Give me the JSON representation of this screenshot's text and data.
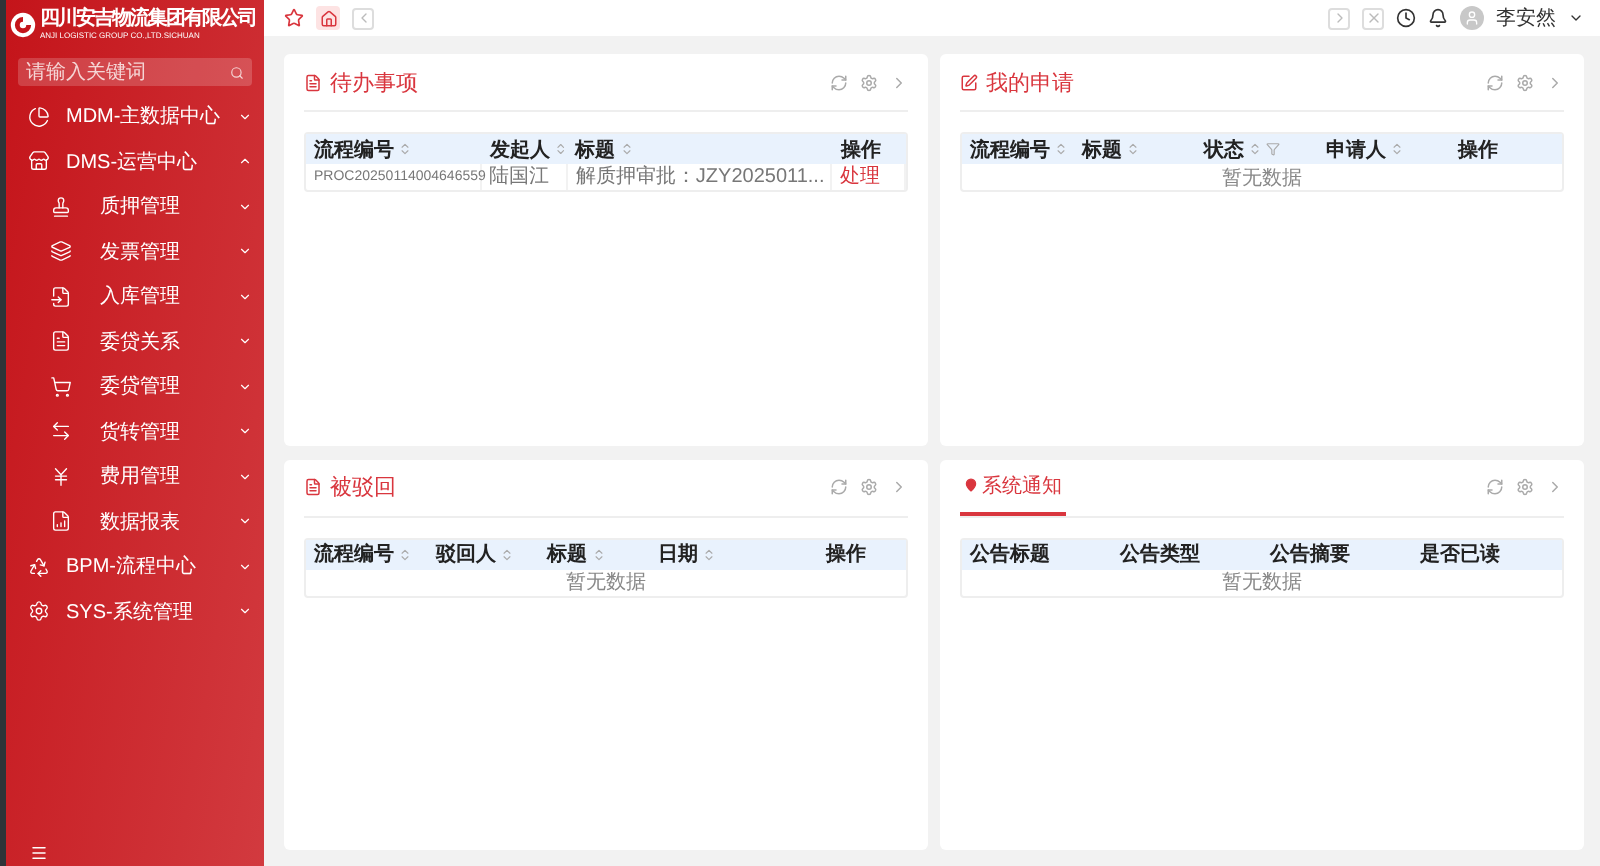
{
  "logo": {
    "name": "四川安吉物流集团有限公司",
    "subtitle": "ANJI LOGISTIC GROUP CO.,LTD.SICHUAN"
  },
  "sidebar": {
    "search": {
      "placeholder": "请输入关键词"
    },
    "items": [
      {
        "label": "MDM-主数据中心",
        "expanded": false
      },
      {
        "label": "DMS-运营中心",
        "expanded": true,
        "children": [
          {
            "label": "质押管理",
            "expanded": false
          },
          {
            "label": "发票管理",
            "expanded": false
          },
          {
            "label": "入库管理",
            "expanded": false
          },
          {
            "label": "委贷关系",
            "expanded": false
          },
          {
            "label": "委贷管理",
            "expanded": false
          },
          {
            "label": "货转管理",
            "expanded": false
          },
          {
            "label": "费用管理",
            "expanded": false
          },
          {
            "label": "数据报表",
            "expanded": false
          }
        ]
      },
      {
        "label": "BPM-流程中心",
        "expanded": false
      },
      {
        "label": "SYS-系统管理",
        "expanded": false
      }
    ]
  },
  "topbar": {
    "user": "李安然"
  },
  "panels": [
    {
      "kind": "table",
      "title": "待办事项",
      "columns": [
        {
          "label": "流程编号",
          "sortable": true,
          "filterable": false
        },
        {
          "label": "发起人",
          "sortable": true,
          "filterable": false
        },
        {
          "label": "标题",
          "sortable": true,
          "filterable": false
        },
        {
          "label": "操作",
          "sortable": false,
          "filterable": false
        }
      ],
      "rows": [
        [
          {
            "kind": "text",
            "text": "PROC20250114004646559"
          },
          {
            "kind": "text",
            "text": "陆国江"
          },
          {
            "kind": "text",
            "text": "解质押审批：JZY2025011..."
          },
          {
            "kind": "link",
            "text": "处理"
          }
        ]
      ]
    },
    {
      "kind": "table",
      "title": "我的申请",
      "columns": [
        {
          "label": "流程编号",
          "sortable": true,
          "filterable": false
        },
        {
          "label": "标题",
          "sortable": true,
          "filterable": false
        },
        {
          "label": "状态",
          "sortable": true,
          "filterable": true
        },
        {
          "label": "申请人",
          "sortable": true,
          "filterable": false
        },
        {
          "label": "操作",
          "sortable": false,
          "filterable": false
        }
      ],
      "empty_text": "暂无数据"
    },
    {
      "kind": "table",
      "title": "被驳回",
      "columns": [
        {
          "label": "流程编号",
          "sortable": true,
          "filterable": false
        },
        {
          "label": "驳回人",
          "sortable": true,
          "filterable": false
        },
        {
          "label": "标题",
          "sortable": true,
          "filterable": false
        },
        {
          "label": "日期",
          "sortable": true,
          "filterable": false
        },
        {
          "label": "操作",
          "sortable": false,
          "filterable": false
        }
      ],
      "empty_text": "暂无数据"
    },
    {
      "kind": "tabs",
      "tabs": [
        {
          "label": "系统通知",
          "selected": true
        }
      ],
      "columns": [
        {
          "label": "公告标题",
          "sortable": false,
          "filterable": false
        },
        {
          "label": "公告类型",
          "sortable": false,
          "filterable": false
        },
        {
          "label": "公告摘要",
          "sortable": false,
          "filterable": false
        },
        {
          "label": "是否已读",
          "sortable": false,
          "filterable": false
        }
      ],
      "empty_text": "暂无数据"
    }
  ]
}
